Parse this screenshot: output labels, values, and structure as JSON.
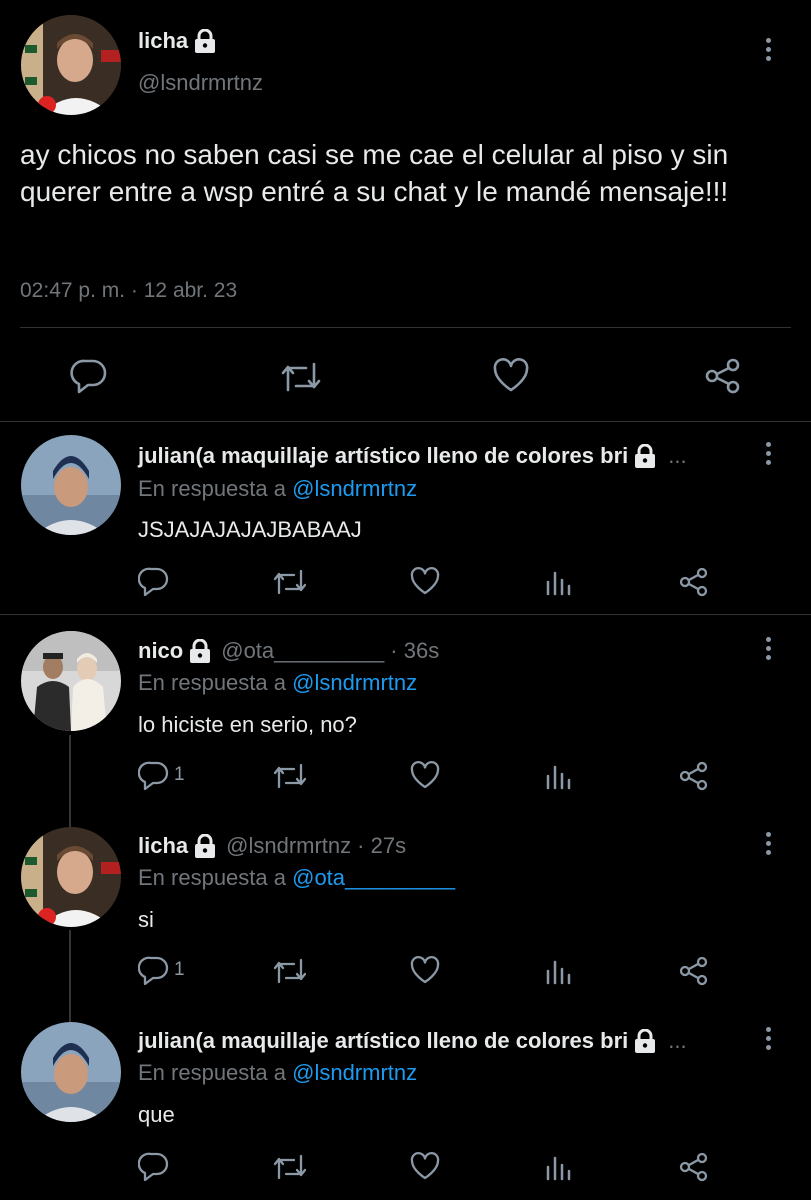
{
  "main_tweet": {
    "name": "licha",
    "handle": "@lsndrmrtnz",
    "text": "ay chicos no saben casi se me cae el celular al piso y sin querer entre a wsp entré a su chat y le mandé mensaje!!!",
    "time": "02:47 p. m.",
    "separator": "·",
    "date": "12 abr. 23"
  },
  "replies": [
    {
      "name": "julian(a maquillaje artístico lleno de colores bri",
      "ellipsis": "...",
      "reply_prefix": "En respuesta a",
      "reply_to": "@lsndrmrtnz",
      "text": "JSJAJAJAJAJBABAAJ",
      "reply_count": ""
    },
    {
      "name": "nico",
      "handle": "@ota_________",
      "time": "· 36s",
      "reply_prefix": "En respuesta a",
      "reply_to": "@lsndrmrtnz",
      "text": "lo hiciste en serio, no?",
      "reply_count": "1"
    },
    {
      "name": "licha",
      "handle": "@lsndrmrtnz",
      "time": "· 27s",
      "reply_prefix": "En respuesta a",
      "reply_to": "@ota_________",
      "text": "si",
      "reply_count": "1"
    },
    {
      "name": "julian(a maquillaje artístico lleno de colores bri",
      "ellipsis": "...",
      "reply_prefix": "En respuesta a",
      "reply_to": "@lsndrmrtnz",
      "text": "que",
      "reply_count": ""
    }
  ],
  "colors": {
    "background": "#000000",
    "text": "#e7e9ea",
    "muted": "#71767b",
    "link": "#1d9bf0",
    "divider": "#2f3336"
  },
  "icons": [
    "lock-icon",
    "more-options-icon",
    "reply-icon",
    "retweet-icon",
    "like-icon",
    "views-icon",
    "share-icon"
  ]
}
